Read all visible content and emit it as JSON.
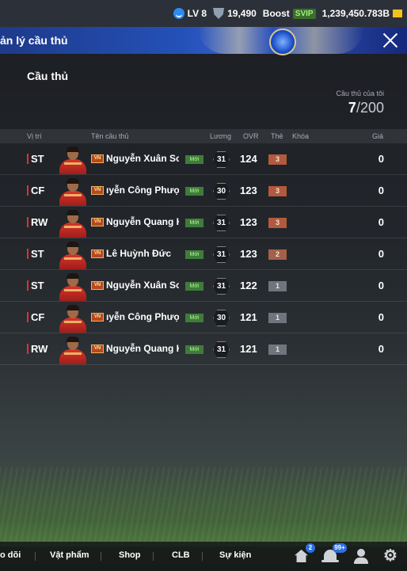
{
  "status": {
    "level": "LV 8",
    "points": "19,490",
    "boost_label": "Boost",
    "svip_label": "SVIP",
    "coins": "1,239,450.783B"
  },
  "header": {
    "title": "ản lý cầu thủ"
  },
  "section": {
    "title": "Cầu thủ",
    "count_label": "Cầu thủ của tôi",
    "count_current": "7",
    "count_sep": "/",
    "count_max": "200"
  },
  "columns": {
    "position": "Vị trí",
    "name": "Tên cầu thủ",
    "salary": "Lương",
    "ovr": "OVR",
    "card": "Thẻ",
    "lock": "Khóa",
    "price": "Giá"
  },
  "season_badge": "VN",
  "new_label": "Mới",
  "players": [
    {
      "position": "ST",
      "name": "Nguyễn Xuân Son",
      "truncate": "none",
      "salary": "31",
      "ovr": "124",
      "grade": "3",
      "grade_color": "#b25a3d",
      "price": "0"
    },
    {
      "position": "CF",
      "name": "ıyễn Công Phượng",
      "truncate": "left",
      "salary": "30",
      "ovr": "123",
      "grade": "3",
      "grade_color": "#b25a3d",
      "price": "0"
    },
    {
      "position": "RW",
      "name": "Nguyễn Quang Hả",
      "truncate": "right",
      "salary": "31",
      "ovr": "123",
      "grade": "3",
      "grade_color": "#b25a3d",
      "price": "0"
    },
    {
      "position": "ST",
      "name": "Lê Huỳnh Đức",
      "truncate": "none",
      "salary": "31",
      "ovr": "123",
      "grade": "2",
      "grade_color": "#a3614a",
      "price": "0"
    },
    {
      "position": "ST",
      "name": "Nguyễn Xuân Son",
      "truncate": "none",
      "salary": "31",
      "ovr": "122",
      "grade": "1",
      "grade_color": "#6f757c",
      "price": "0"
    },
    {
      "position": "CF",
      "name": "ıyễn Công Phượng",
      "truncate": "left",
      "salary": "30",
      "ovr": "121",
      "grade": "1",
      "grade_color": "#6f757c",
      "price": "0"
    },
    {
      "position": "RW",
      "name": "Nguyễn Quang Hả",
      "truncate": "right",
      "salary": "31",
      "ovr": "121",
      "grade": "1",
      "grade_color": "#6f757c",
      "price": "0"
    }
  ],
  "bottom_nav": {
    "follow": "o dõi",
    "items": "Vật phẩm",
    "shop": "Shop",
    "club": "CLB",
    "events": "Sự kiện",
    "home_badge": "2",
    "bell_badge": "99+"
  },
  "icons": {
    "level": "smile-badge-icon",
    "points": "shield-icon",
    "coins": "coin-icon",
    "close": "close-icon",
    "home": "home-icon",
    "notifications": "bell-icon",
    "profile": "user-icon",
    "settings": "gear-icon"
  }
}
